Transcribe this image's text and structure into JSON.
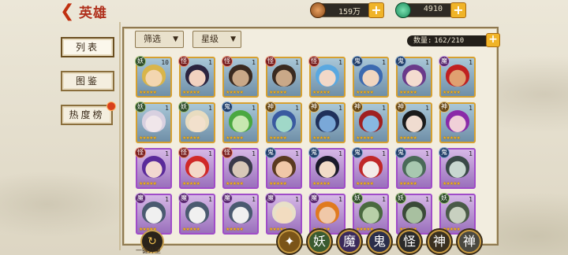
{
  "header": {
    "back_icon": "back-arrow-icon",
    "title": "英雄"
  },
  "resources": {
    "coins": {
      "value": "159万",
      "icon": "coin-icon"
    },
    "jade": {
      "value": "4910",
      "icon": "jade-icon"
    },
    "plus": "+"
  },
  "sidebar": {
    "items": [
      {
        "label": "列表"
      },
      {
        "label": "图鉴"
      },
      {
        "label": "热度榜"
      }
    ]
  },
  "filters": {
    "filter_label": "筛选",
    "star_label": "星级",
    "arrow": "▼"
  },
  "count": {
    "label": "数量:",
    "value": "162/210"
  },
  "heroes": [
    {
      "cls": "妖",
      "lvl": "10",
      "tone": "gold",
      "skin": "#f3d6b0",
      "hair": "#d9b54a"
    },
    {
      "cls": "怪",
      "lvl": "1",
      "tone": "gold",
      "skin": "#f2d2c0",
      "hair": "#2b2440"
    },
    {
      "cls": "怪",
      "lvl": "1",
      "tone": "gold",
      "skin": "#c9a888",
      "hair": "#3a2a20"
    },
    {
      "cls": "怪",
      "lvl": "1",
      "tone": "gold",
      "skin": "#c9a888",
      "hair": "#3a2a20"
    },
    {
      "cls": "怪",
      "lvl": "1",
      "tone": "gold",
      "skin": "#f2d8c8",
      "hair": "#5aa8e0"
    },
    {
      "cls": "鬼",
      "lvl": "1",
      "tone": "gold",
      "skin": "#f0d6c0",
      "hair": "#3c6ab0"
    },
    {
      "cls": "鬼",
      "lvl": "1",
      "tone": "gold",
      "skin": "#f4dcd0",
      "hair": "#6a3a8a"
    },
    {
      "cls": "魔",
      "lvl": "1",
      "tone": "gold",
      "skin": "#e0a070",
      "hair": "#c02020"
    },
    {
      "cls": "妖",
      "lvl": "1",
      "tone": "gold",
      "skin": "#f0e6ea",
      "hair": "#d8d0e0"
    },
    {
      "cls": "妖",
      "lvl": "1",
      "tone": "gold",
      "skin": "#f2e0cc",
      "hair": "#e8dcc0"
    },
    {
      "cls": "鬼",
      "lvl": "1",
      "tone": "gold",
      "skin": "#c8e8b0",
      "hair": "#4aa840"
    },
    {
      "cls": "神",
      "lvl": "1",
      "tone": "gold",
      "skin": "#a0d8c8",
      "hair": "#3a5aa0"
    },
    {
      "cls": "神",
      "lvl": "1",
      "tone": "gold",
      "skin": "#7aa8d8",
      "hair": "#20305a"
    },
    {
      "cls": "神",
      "lvl": "1",
      "tone": "gold",
      "skin": "#88b8e0",
      "hair": "#a02020"
    },
    {
      "cls": "神",
      "lvl": "1",
      "tone": "gold",
      "skin": "#f0dcd0",
      "hair": "#1a1a1a"
    },
    {
      "cls": "神",
      "lvl": "1",
      "tone": "gold",
      "skin": "#f0d0d8",
      "hair": "#8a2aa8"
    },
    {
      "cls": "怪",
      "lvl": "1",
      "tone": "purple",
      "skin": "#f2d8d0",
      "hair": "#5a2a9a"
    },
    {
      "cls": "怪",
      "lvl": "1",
      "tone": "purple",
      "skin": "#f4d8c8",
      "hair": "#d02828"
    },
    {
      "cls": "怪",
      "lvl": "1",
      "tone": "purple",
      "skin": "#d8c8b8",
      "hair": "#3a3a4a"
    },
    {
      "cls": "鬼",
      "lvl": "1",
      "tone": "purple",
      "skin": "#f0c8a8",
      "hair": "#5a3a20"
    },
    {
      "cls": "鬼",
      "lvl": "1",
      "tone": "purple",
      "skin": "#f2dcc8",
      "hair": "#1a1a2a"
    },
    {
      "cls": "鬼",
      "lvl": "1",
      "tone": "purple",
      "skin": "#f4ece8",
      "hair": "#c02828"
    },
    {
      "cls": "鬼",
      "lvl": "1",
      "tone": "purple",
      "skin": "#a8c8b0",
      "hair": "#4a6a58"
    },
    {
      "cls": "鬼",
      "lvl": "1",
      "tone": "purple",
      "skin": "#c8d8d0",
      "hair": "#3a4a48"
    },
    {
      "cls": "魔",
      "lvl": "1",
      "tone": "purple",
      "skin": "#f0f0f0",
      "hair": "#4a5a70"
    },
    {
      "cls": "魔",
      "lvl": "1",
      "tone": "purple",
      "skin": "#f0f0f0",
      "hair": "#4a5a70"
    },
    {
      "cls": "魔",
      "lvl": "1",
      "tone": "purple",
      "skin": "#f0f0f0",
      "hair": "#4a5a70"
    },
    {
      "cls": "魔",
      "lvl": "1",
      "tone": "purple",
      "skin": "#f2dcc0",
      "hair": "#e8e0c8"
    },
    {
      "cls": "魔",
      "lvl": "1",
      "tone": "purple",
      "skin": "#f0c8a8",
      "hair": "#e07a20"
    },
    {
      "cls": "妖",
      "lvl": "1",
      "tone": "purple",
      "skin": "#b8d0a8",
      "hair": "#4a6a40"
    },
    {
      "cls": "妖",
      "lvl": "1",
      "tone": "purple",
      "skin": "#a8c0a0",
      "hair": "#3a4a38"
    },
    {
      "cls": "妖",
      "lvl": "1",
      "tone": "purple",
      "skin": "#c8d0c0",
      "hair": "#4a5a48"
    }
  ],
  "stars": "★★★★★",
  "bottom": {
    "one_key_icon": "upgrade-icon",
    "one_key_label": "一键升星",
    "factions": [
      {
        "label": "",
        "icon": "all-faction-icon",
        "color": "#7a5418"
      },
      {
        "label": "妖",
        "color": "#3a5a30"
      },
      {
        "label": "魔",
        "color": "#3a2a5a"
      },
      {
        "label": "鬼",
        "color": "#2a2e4a"
      },
      {
        "label": "怪",
        "color": "#2a2a2a"
      },
      {
        "label": "神",
        "color": "#3a3020"
      },
      {
        "label": "禅",
        "color": "#4a4840"
      }
    ]
  }
}
